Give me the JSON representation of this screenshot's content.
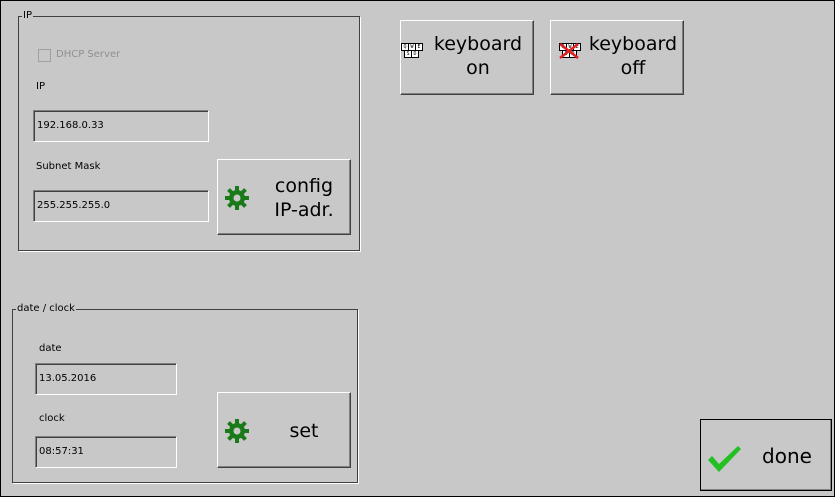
{
  "ip_group": {
    "legend": "IP",
    "dhcp_label": "DHCP Server",
    "ip_label": "IP",
    "ip_value": "192.168.0.33",
    "subnet_label": "Subnet Mask",
    "subnet_value": "255.255.255.0",
    "config_button": {
      "line1": "config",
      "line2": "IP-adr."
    }
  },
  "date_group": {
    "legend": "date / clock",
    "date_label": "date",
    "date_value": "13.05.2016",
    "clock_label": "clock",
    "clock_value": "08:57:31",
    "set_button": "set"
  },
  "keyboard_on": {
    "line1": "keyboard",
    "line2": "on",
    "icon": "keyboard-icon"
  },
  "keyboard_off": {
    "line1": "keyboard",
    "line2": "off",
    "icon": "keyboard-off-icon"
  },
  "done_button": {
    "label": "done",
    "icon": "checkmark-icon"
  },
  "colors": {
    "background": "#c8c8c8",
    "gear": "#1a7a1a",
    "check": "#22c022",
    "cross": "#e02020"
  },
  "dhcp_checked": false
}
